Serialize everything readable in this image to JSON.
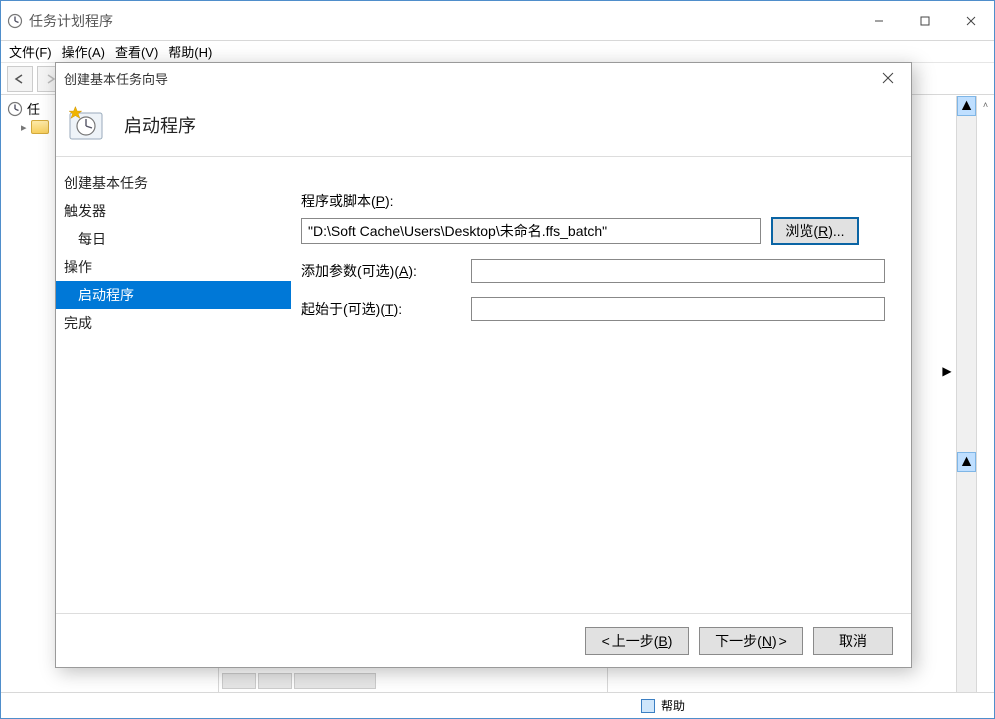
{
  "main_window": {
    "title": "任务计划程序",
    "menu": {
      "file": "文件(F)",
      "action": "操作(A)",
      "view": "查看(V)",
      "help": "帮助(H)"
    },
    "tree": {
      "root": "任",
      "child": ""
    },
    "status": "帮助"
  },
  "dialog": {
    "title": "创建基本任务向导",
    "header": "启动程序",
    "nav": {
      "create": "创建基本任务",
      "trigger": "触发器",
      "trigger_sub": "每日",
      "action": "操作",
      "action_sub": "启动程序",
      "finish": "完成"
    },
    "fields": {
      "script_label_pre": "程序或脚本(",
      "script_label_u": "P",
      "script_label_post": "):",
      "script_value": "\"D:\\Soft Cache\\Users\\Desktop\\未命名.ffs_batch\"",
      "browse_pre": "浏览(",
      "browse_u": "R",
      "browse_post": ")...",
      "args_label_pre": "添加参数(可选)(",
      "args_label_u": "A",
      "args_label_post": "):",
      "args_value": "",
      "start_label_pre": "起始于(可选)(",
      "start_label_u": "T",
      "start_label_post": "):",
      "start_value": ""
    },
    "buttons": {
      "back_pre": "上一步(",
      "back_u": "B",
      "back_post": ")",
      "next_pre": "下一步(",
      "next_u": "N",
      "next_post": ")",
      "cancel": "取消"
    }
  }
}
